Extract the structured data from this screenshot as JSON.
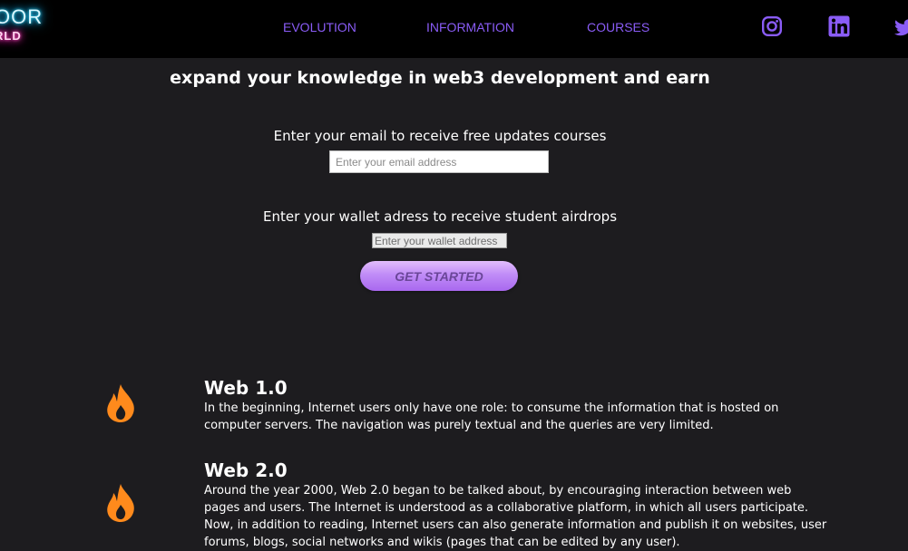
{
  "header": {
    "logo": {
      "line1": "OOR",
      "line2": "RLD"
    },
    "nav": [
      {
        "label": "EVOLUTION"
      },
      {
        "label": "INFORMATION"
      },
      {
        "label": "COURSES"
      }
    ],
    "social": [
      "instagram-icon",
      "linkedin-icon",
      "twitter-icon"
    ]
  },
  "hero": {
    "tagline": "expand your knowledge in web3 development and earn",
    "email_label": "Enter your email to receive free updates courses",
    "email_placeholder": "Enter your email address",
    "wallet_label": "Enter your wallet adress to receive student airdrops",
    "wallet_placeholder": "Enter your wallet address",
    "cta_label": "GET STARTED"
  },
  "sections": [
    {
      "icon": "fire-icon",
      "title": "Web 1.0",
      "body": "In the beginning, Internet users only have one role: to consume the information that is hosted on computer servers. The navigation was purely textual and the queries are very limited."
    },
    {
      "icon": "fire-icon",
      "title": "Web 2.0",
      "body": "Around the year 2000, Web 2.0 began to be talked about, by encouraging interaction between web pages and users. The Internet is understood as a collaborative platform, in which all users participate. Now, in addition to reading, Internet users can also generate information and publish it on websites, user forums, blogs, social networks and wikis (pages that can be edited by any user)."
    }
  ],
  "colors": {
    "background": "#1d1c1f",
    "header": "#000000",
    "nav_link": "#8a5cf6",
    "accent": "#a968ef",
    "fire": "#ff8a1c"
  }
}
